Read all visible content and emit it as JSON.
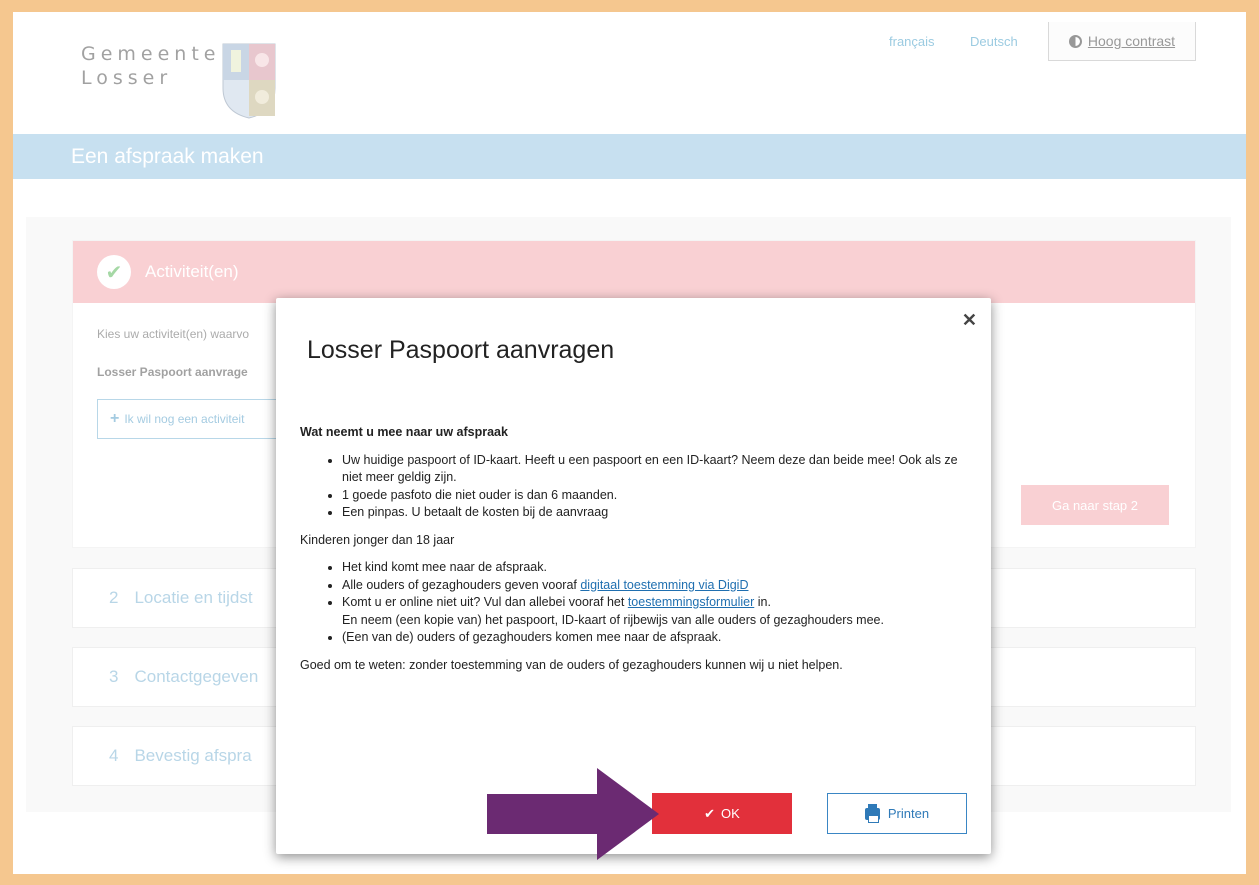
{
  "header": {
    "logo_line1": "Gemeente",
    "logo_line2": "Losser",
    "lang_fr": "français",
    "lang_de": "Deutsch",
    "contrast_label": "Hoog contrast"
  },
  "banner": {
    "title": "Een afspraak maken"
  },
  "step1": {
    "title": "Activiteit(en)",
    "description": "Kies uw activiteit(en) waarvo",
    "selected_activity": "Losser Paspoort aanvrage",
    "add_activity_label": "Ik wil nog een activiteit",
    "next_label": "Ga naar stap 2"
  },
  "steps": [
    {
      "num": "2",
      "label": "Locatie en tijdst"
    },
    {
      "num": "3",
      "label": "Contactgegeven"
    },
    {
      "num": "4",
      "label": "Bevestig afspra"
    }
  ],
  "modal": {
    "title": "Losser Paspoort aanvragen",
    "heading": "Wat neemt u mee naar uw afspraak",
    "list1": [
      "Uw huidige paspoort of ID-kaart. Heeft u een paspoort en een ID-kaart? Neem deze dan beide mee! Ook als ze niet meer geldig zijn.",
      "1 goede pasfoto die niet ouder is dan 6 maanden.",
      "Een pinpas. U betaalt de kosten bij de aanvraag"
    ],
    "children_heading": "Kinderen jonger dan 18 jaar",
    "child1": "Het kind komt mee naar de afspraak.",
    "child2_pre": "Alle ouders of gezaghouders geven vooraf ",
    "child2_link": "digitaal toestemming via DigiD",
    "child3_pre": "Komt u er online niet uit? Vul dan allebei vooraf het ",
    "child3_link": "toestemmingsformulier",
    "child3_post": " in.",
    "child3_line2": "En neem (een kopie van) het paspoort, ID-kaart of rijbewijs van alle ouders of gezaghouders mee.",
    "child4": "(Een van de) ouders of gezaghouders komen mee naar de afspraak.",
    "footer_note": "Goed om te weten: zonder toestemming van de ouders of gezaghouders kunnen wij u niet helpen.",
    "ok_label": "OK",
    "print_label": "Printen"
  },
  "colors": {
    "banner": "#9ac6e3",
    "step_active": "#f5a9b0",
    "ok_button": "#e2303b",
    "arrow": "#6b2a72",
    "frame": "#f5c78f"
  }
}
